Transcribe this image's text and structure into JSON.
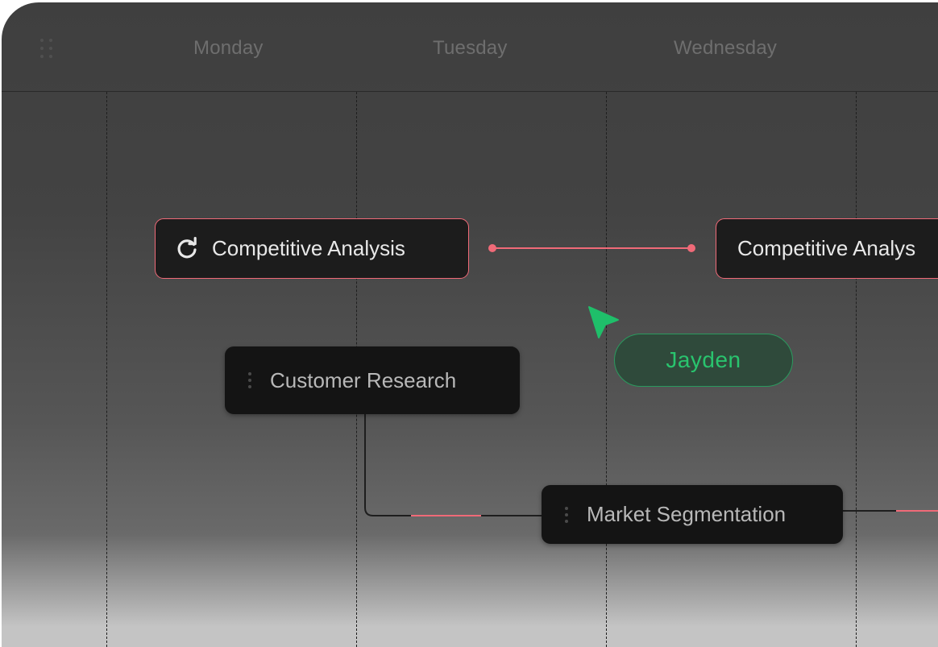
{
  "header": {
    "days": [
      "Monday",
      "Tuesday",
      "Wednesday"
    ]
  },
  "tasks": {
    "competitive_analysis": "Competitive Analysis",
    "competitive_analysis_next": "Competitive Analys",
    "customer_research": "Customer Research",
    "market_segmentation": "Market Segmentation"
  },
  "collaborator": {
    "name": "Jayden"
  },
  "colors": {
    "accent": "#f06a78",
    "cursor": "#1fbf6a",
    "card_bg": "#161616",
    "board_bg": "#434343"
  },
  "icons": {
    "grip": "grip-dots-icon",
    "refresh": "refresh-icon",
    "drag": "drag-handle-icon",
    "cursor": "cursor-pointer-icon"
  }
}
